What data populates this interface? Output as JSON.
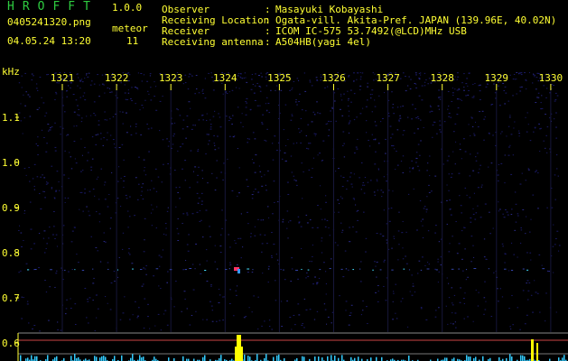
{
  "app": {
    "title": "HROFFT",
    "version": "1.0.0"
  },
  "file": {
    "name": "0405241320.png",
    "datetime": "04.05.24 13:20"
  },
  "meteor": {
    "label": "meteor",
    "count": "11"
  },
  "info": [
    {
      "label": "Observer",
      "value": "Masayuki Kobayashi"
    },
    {
      "label": "Receiving Location",
      "value": "Ogata-vill. Akita-Pref. JAPAN (139.96E, 40.02N)"
    },
    {
      "label": "Receiver",
      "value": "ICOM IC-575 53.7492(@LCD)MHz USB"
    },
    {
      "label": "Receiving antenna",
      "value": "A504HB(yagi 4el)"
    }
  ],
  "axes": {
    "y_unit": "kHz",
    "y_ticks": [
      "1.1",
      "1.0",
      "0.9",
      "0.8",
      "0.7",
      "0.6"
    ],
    "x_ticks": [
      "1321",
      "1322",
      "1323",
      "1324",
      "1325",
      "1326",
      "1327",
      "1328",
      "1329",
      "1330"
    ]
  },
  "colors": {
    "text": "#ffff33",
    "title": "#2ecc40",
    "background": "#000000",
    "noise": "#1a1a66",
    "spectrum": "#33ccff",
    "peak": "#ffff00"
  }
}
